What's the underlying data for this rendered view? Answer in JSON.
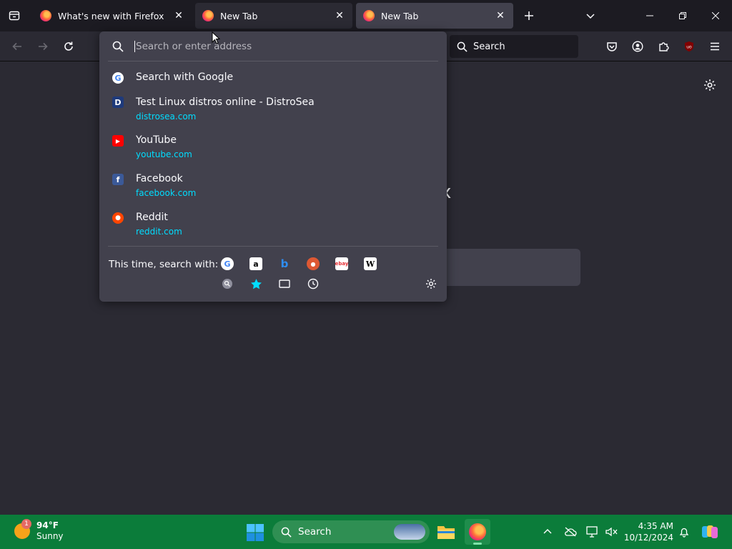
{
  "tabs": [
    {
      "label": "What's new with Firefox",
      "active": false
    },
    {
      "label": "New Tab",
      "active": false
    },
    {
      "label": "New Tab",
      "active": true
    }
  ],
  "nav": {
    "search_placeholder": "Search"
  },
  "urlbar": {
    "placeholder": "Search or enter address",
    "value": ""
  },
  "results": [
    {
      "title": "Search with Google",
      "url": "",
      "icon": "google-g-icon"
    },
    {
      "title": "Test Linux distros online - DistroSea",
      "url": "distrosea.com",
      "icon": "distrosea-icon"
    },
    {
      "title": "YouTube",
      "url": "youtube.com",
      "icon": "youtube-icon"
    },
    {
      "title": "Facebook",
      "url": "facebook.com",
      "icon": "facebook-icon"
    },
    {
      "title": "Reddit",
      "url": "reddit.com",
      "icon": "reddit-icon"
    }
  ],
  "oneoff": {
    "label": "This time, search with:",
    "engines": [
      "Google",
      "Amazon",
      "Bing",
      "DuckDuckGo",
      "eBay",
      "Wikipedia"
    ],
    "modes": [
      "history-search",
      "bookmarks",
      "tabs",
      "history"
    ]
  },
  "taskbar": {
    "weather_temp": "94°F",
    "weather_cond": "Sunny",
    "weather_badge": "1",
    "search_label": "Search",
    "time": "4:35 AM",
    "date": "10/12/2024"
  },
  "colors": {
    "accent_url": "#00ddff",
    "popup_bg": "#42414d",
    "taskbar_bg": "#0b7c3a"
  }
}
